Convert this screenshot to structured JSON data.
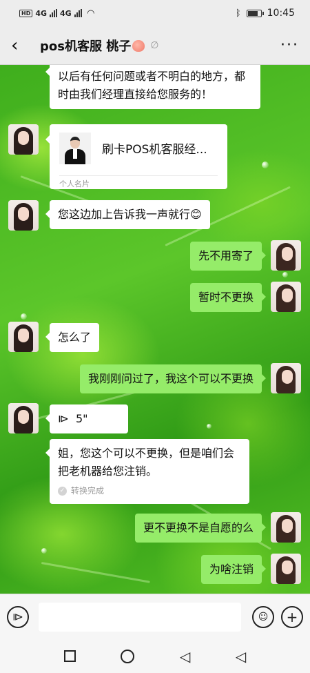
{
  "status_bar": {
    "network": "HD",
    "signal_1": "4G",
    "signal_2": "4G",
    "time": "10:45"
  },
  "header": {
    "title": "pos机客服 桃子",
    "back_icon": "chevron-left-icon",
    "more_label": "···"
  },
  "messages": [
    {
      "type": "text",
      "side": "in",
      "text": "以后有任何问题或者不明白的地方，都时由我们经理直接给您服务的！"
    },
    {
      "type": "card",
      "side": "in",
      "name": "刷卡POS机客服经...",
      "footer": "个人名片"
    },
    {
      "type": "text",
      "side": "in",
      "text": "您这边加上告诉我一声就行😊"
    },
    {
      "type": "text",
      "side": "out",
      "text": "先不用寄了"
    },
    {
      "type": "text",
      "side": "out",
      "text": "暂时不更换"
    },
    {
      "type": "text",
      "side": "in",
      "text": "怎么了"
    },
    {
      "type": "text",
      "side": "out",
      "text": "我刚刚问过了，我这个可以不更换"
    },
    {
      "type": "voice",
      "side": "in",
      "duration": "5\""
    },
    {
      "type": "transcript",
      "side": "in",
      "text": "姐，您这个可以不更换，但是咱们会把老机器给您注销。",
      "note": "转换完成"
    },
    {
      "type": "text",
      "side": "out",
      "text": "更不更换不是自愿的么"
    },
    {
      "type": "text",
      "side": "out",
      "text": "为啥注销"
    }
  ],
  "input_bar": {
    "voice_icon": "voice-mode-icon",
    "emoji_icon": "emoji-icon",
    "plus_icon": "plus-icon"
  },
  "colors": {
    "outgoing_bubble": "#95ec69",
    "incoming_bubble": "#ffffff",
    "bar_bg": "#ededed"
  }
}
